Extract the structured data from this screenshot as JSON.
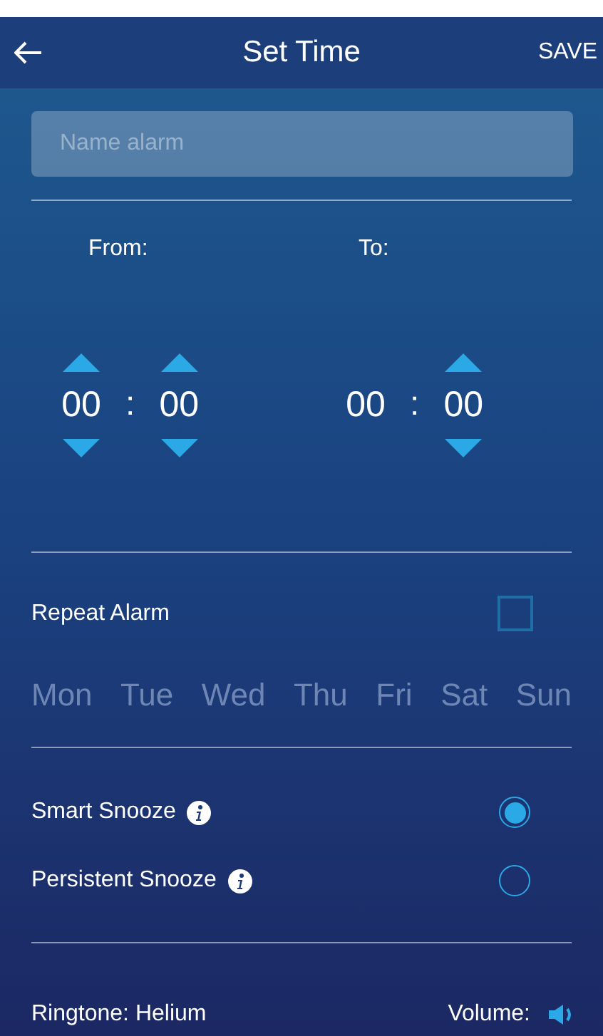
{
  "header": {
    "title": "Set Time",
    "action": "SAVE"
  },
  "name_field": {
    "placeholder": "Name alarm"
  },
  "times": [
    {
      "label": "From:",
      "parts": [
        {
          "value": "00",
          "arrows": true
        },
        {
          "value": "00",
          "arrows": true
        }
      ],
      "separator": ":"
    },
    {
      "label": "To:",
      "parts": [
        {
          "value": "00",
          "arrows": false
        },
        {
          "value": "00",
          "arrows": true
        }
      ],
      "separator": ":"
    }
  ],
  "repeat": {
    "label": "Repeat Alarm",
    "checked": false
  },
  "days": [
    {
      "label": "Mon",
      "selected": false
    },
    {
      "label": "Tue",
      "selected": false
    },
    {
      "label": "Wed",
      "selected": false
    },
    {
      "label": "Thu",
      "selected": false
    },
    {
      "label": "Fri",
      "selected": false
    },
    {
      "label": "Sat",
      "selected": false
    },
    {
      "label": "Sun",
      "selected": false
    }
  ],
  "snooze_options": [
    {
      "label": "Smart Snooze",
      "selected": true
    },
    {
      "label": "Persistent Snooze",
      "selected": false
    }
  ],
  "ringtone": {
    "label": "Ringtone:",
    "value": "Helium"
  },
  "volume": {
    "label": "Volume:"
  }
}
